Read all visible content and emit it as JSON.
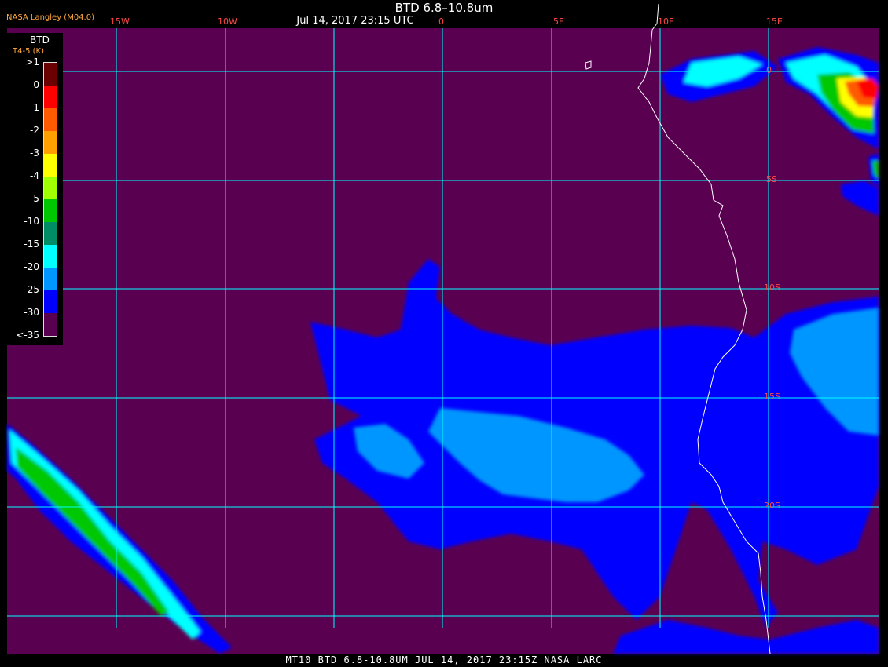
{
  "title": "BTD 6.8–10.8um",
  "date": "Jul 14, 2017 23:15 UTC",
  "credit": "NASA Langley (M04.0)",
  "footer": "MT10  BTD 6.8-10.8UM  JUL 14, 2017 23:15Z  NASA LARC",
  "legend": {
    "title": "BTD",
    "subtitle": "T4-5 (K)",
    "labels": [
      ">1",
      "0",
      "-1",
      "-2",
      "-3",
      "-4",
      "-5",
      "-10",
      "-15",
      "-20",
      "-25",
      "-30",
      "<-35"
    ],
    "colors": [
      "#6b0000",
      "#ff0000",
      "#ff5a00",
      "#ffa000",
      "#ffff00",
      "#a0ff00",
      "#00c800",
      "#008c64",
      "#00ffff",
      "#0096ff",
      "#0000ff",
      "#5a0050"
    ]
  },
  "grid": {
    "lon_labels": [
      "15W",
      "10W",
      "0",
      "5E",
      "10E",
      "15E"
    ],
    "lat_labels": [
      "0",
      "5S",
      "10S",
      "15S",
      "20S"
    ]
  },
  "colors": {
    "background": "#5a0050",
    "blue": "#0000ff",
    "light_blue": "#0096ff",
    "grid": "#00ffff",
    "coast": "#ffffff"
  }
}
